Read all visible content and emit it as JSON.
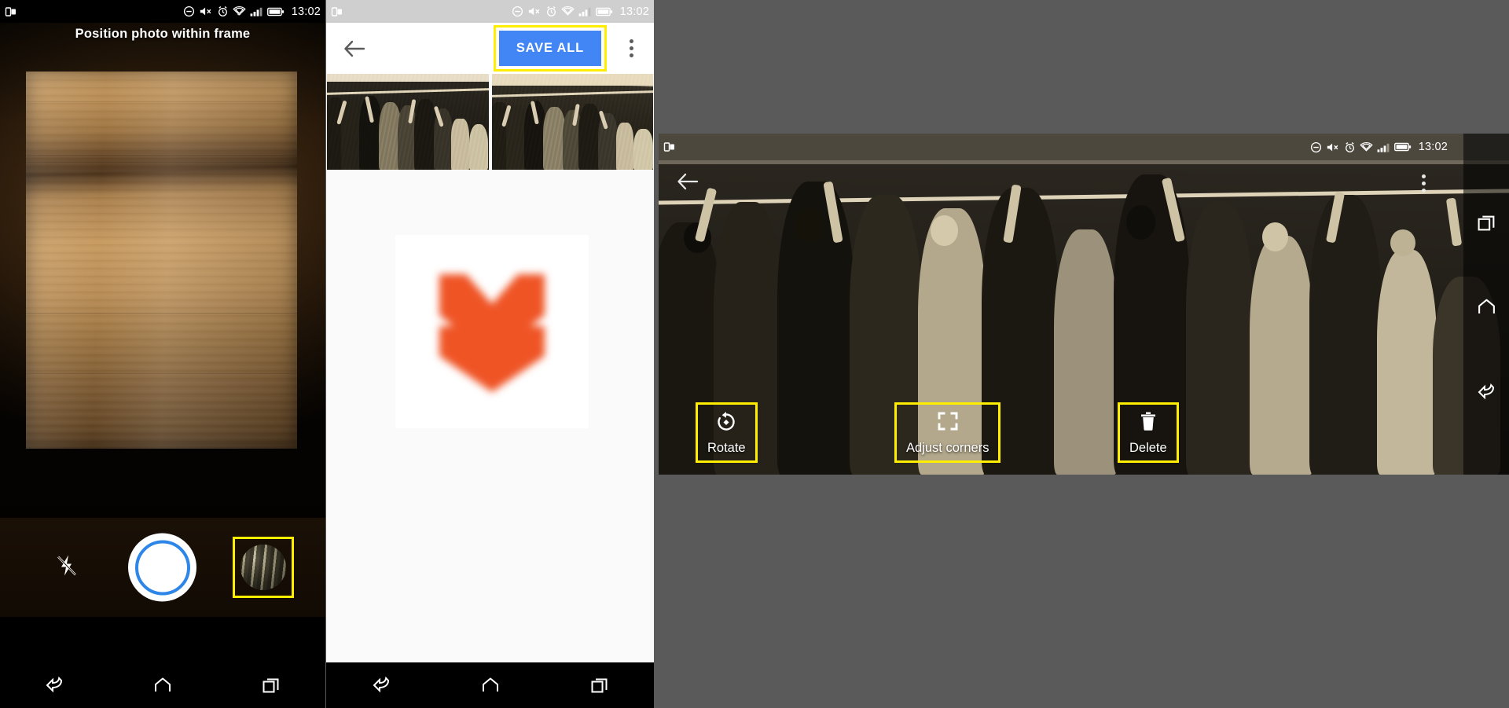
{
  "statusbar": {
    "time": "13:02",
    "icons": [
      "multi-window-icon",
      "do-not-disturb-icon",
      "mute-icon",
      "alarm-icon",
      "wifi-icon",
      "signal-icon",
      "battery-icon"
    ]
  },
  "panel1": {
    "name": "camera-capture-screen",
    "title": "Position photo within frame",
    "controls": {
      "flash": "flash-off-icon",
      "shutter": "shutter-button",
      "thumbnail": "last-photo-thumbnail",
      "thumbnail_highlighted": true
    },
    "navbar": [
      "back-icon",
      "home-icon",
      "recents-icon"
    ]
  },
  "panel2": {
    "name": "photo-review-screen",
    "back_label": "back-arrow-icon",
    "save_all_label": "SAVE ALL",
    "save_all_highlighted": true,
    "overflow_label": "more-options-icon",
    "thumbnails": [
      "scanned-photo-1",
      "scanned-photo-2"
    ],
    "logo": "orange-double-chevron-logo",
    "logo_color": "#ef5425",
    "accent_color": "#4285f4",
    "highlight_color": "#ffee00",
    "navbar": [
      "back-icon",
      "home-icon",
      "recents-icon"
    ]
  },
  "panel3": {
    "name": "photo-edit-screen",
    "back_label": "back-arrow-icon",
    "overflow_label": "more-options-icon",
    "tools": [
      {
        "id": "rotate",
        "label": "Rotate",
        "icon": "rotate-icon",
        "highlighted": true
      },
      {
        "id": "adjust-corners",
        "label": "Adjust corners",
        "icon": "crop-corners-icon",
        "highlighted": true
      },
      {
        "id": "delete",
        "label": "Delete",
        "icon": "trash-icon",
        "highlighted": true
      }
    ],
    "navbar": [
      "recents-icon",
      "home-icon",
      "back-icon"
    ]
  }
}
